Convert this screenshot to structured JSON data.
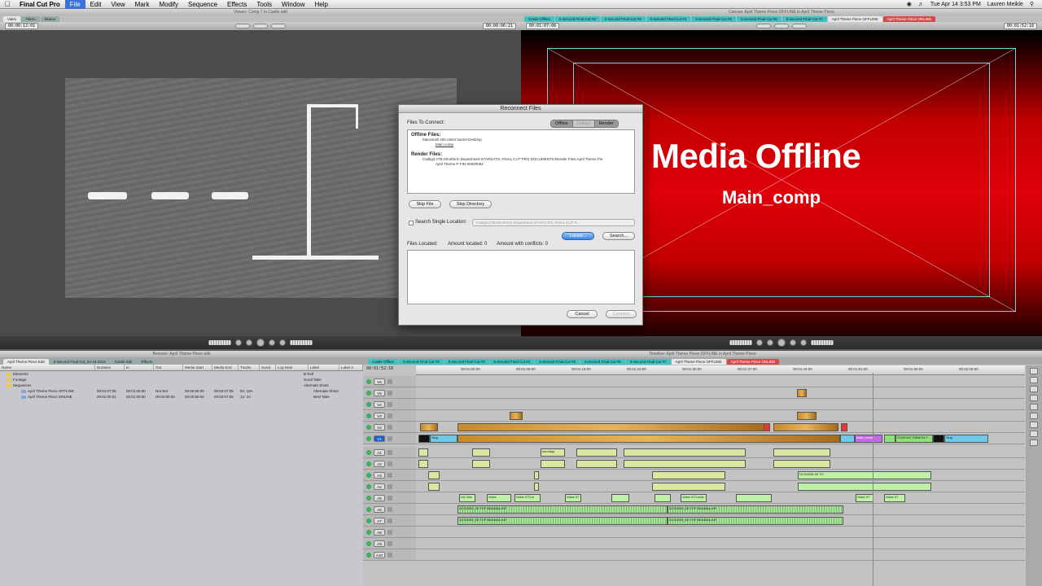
{
  "menubar": {
    "app": "Final Cut Pro",
    "items": [
      "File",
      "Edit",
      "View",
      "Mark",
      "Modify",
      "Sequence",
      "Effects",
      "Tools",
      "Window",
      "Help"
    ],
    "active": "File",
    "clock": "Tue Apr 14  3:53 PM",
    "user": "Lauren Meikle"
  },
  "viewer": {
    "title": "Viewer: Comp 7 in Castle edit",
    "tabs": [
      "Video",
      "Filters",
      "Motion"
    ],
    "tc_left": "00:00:12:01",
    "tc_right": "00:00:06:21",
    "zoom": "100%"
  },
  "canvas": {
    "title": "Canvas: April Theme Piece OFFLINE in April Theme Piece",
    "tabs": [
      "Castle Offline",
      "5-Second Final Cut #2",
      "5-Second Final Cut #3",
      "5-Second Final Cut #4",
      "5-Second Final Cut #5",
      "5-Second Final Cut #6",
      "5-Second Final Cut #7",
      "April Theme Piece OFFLINE",
      "April Theme Piece ONLINE"
    ],
    "tc_left": "00:01:07:06",
    "tc_right": "00:01:52:18",
    "offline_title": "Media Offline",
    "offline_sub": "Main_comp"
  },
  "dialog": {
    "title": "Reconnect Files",
    "files_to_connect": "Files To Connect:",
    "seg": [
      "Offline",
      "Online",
      "Render"
    ],
    "offline_label": "Offline Files:",
    "offline_path": "Macintosh HD:Users:lauren:Desktop",
    "offline_file": "Main.comp",
    "render_label": "Render Files:",
    "render_path": "Caldigit 2TB:Shortform Department:STARSAT:8. FINAL CUT PRO DOCUMENTS:Render Files:April Theme Pie",
    "render_file": "April Theme P-FIN-00000084",
    "skip_file": "Skip File",
    "skip_directory": "Skip Directory",
    "search_single": "Search Single Location:",
    "search_single_value": "Caldigit 2TB:Shortform Department:STARSAT:8. FINAL CUT P...",
    "locate": "Locate...",
    "search": "Search...",
    "files_located": "Files Located:",
    "amount_located": "Amount located: 0",
    "amount_conflicts": "Amount with conflicts: 0",
    "cancel": "Cancel",
    "connect": "Connect"
  },
  "browser": {
    "title": "Browser: April Theme Piece edit",
    "tabs": [
      "April Theme Piece Edit",
      "5-Second Final Cut_04-15-2012",
      "Castle Edit",
      "Effects"
    ],
    "columns": [
      "Name",
      "Duration",
      "In",
      "Out",
      "Media Start",
      "Media End",
      "Tracks",
      "Good",
      "Log Note",
      "Label",
      "Label 2"
    ],
    "rows": [
      {
        "name": "Elements",
        "kind": "folder",
        "notes": "B Roll"
      },
      {
        "name": "Footage",
        "kind": "folder",
        "notes": "Good Take"
      },
      {
        "name": "Sequences",
        "kind": "folder",
        "notes": "Alternate Shots"
      },
      {
        "name": "April Theme Piece OFFLINE",
        "kind": "seq",
        "duration": "00:01:07:06",
        "in": "00:01:00:00",
        "out": "Not Set",
        "mstart": "00:00:55:00",
        "mend": "00:02:07:05",
        "tracks": "8V, 18A",
        "notes": "Alternate Shots"
      },
      {
        "name": "April Theme Piece ONLINE",
        "kind": "seq",
        "duration": "00:01:00:01",
        "in": "00:01:00:00",
        "out": "00:02:00:00",
        "mstart": "00:00:55:00",
        "mend": "00:02:07:05",
        "tracks": "1V, 2A",
        "notes": "Best Take"
      }
    ]
  },
  "timeline": {
    "title": "Timeline: April Theme Piece OFFLINE in April Theme Piece",
    "tabs": [
      "Castle Offline",
      "5-Second Final Cut #2",
      "5-Second Final Cut #3",
      "5-Second Final Cut #4",
      "5-Second Final Cut #5",
      "5-Second Final Cut #6",
      "5-Second Final Cut #7",
      "April Theme Piece OFFLINE",
      "April Theme Piece ONLINE"
    ],
    "timecode": "00:01:52:18",
    "ruler": [
      "00:01:02:00",
      "00:01:09:00",
      "00:01:16:00",
      "00:01:23:00",
      "00:01:30:00",
      "00:01:37:00",
      "00:01:44:00",
      "00:01:51:00",
      "00:01:58:00",
      "00:02:05:00"
    ],
    "video_tracks": [
      "V6",
      "V5",
      "V4",
      "V3",
      "V2",
      "V1"
    ],
    "audio_tracks": [
      "A1",
      "A2",
      "A3",
      "A4",
      "A5",
      "A6",
      "A7",
      "A8",
      "A9",
      "A10"
    ],
    "clip_labels": {
      "slug": "Slug",
      "main_comp": "Main_comp",
      "ribbon": "STARSAT RIBBON F",
      "slug2": "Slug",
      "voice1": "Voi Voic",
      "voice2": "Voice",
      "voice3": "Voice 073.m",
      "voice4": "Voice 07",
      "voice5": "Voice 073.m4a",
      "voice6": "Voice 07",
      "voice7": "Voice 07",
      "banana1": "DCD0039_05 TOP BANANA.AIF",
      "banana2": "DCD0039_05 TOP BANANA.AIF",
      "banana3": "DCD0039_05 TOP BANANA.AIF",
      "banana4": "DCD0039_05 TOP BANANA.AIF",
      "soundup": "soundup",
      "dcd": "DCD0036 05 TO"
    }
  }
}
